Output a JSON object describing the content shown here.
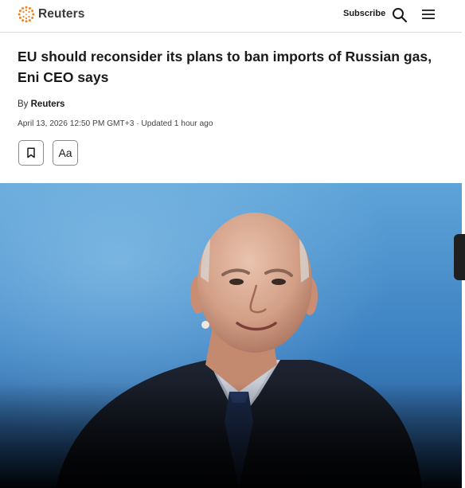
{
  "header": {
    "brand": "Reuters",
    "subscribe_label": "Subscribe",
    "search_icon": "search-icon",
    "menu_icon": "hamburger-menu-icon",
    "brand_color": "#f58220"
  },
  "article": {
    "headline": "EU should reconsider its plans to ban imports of Russian gas, Eni CEO says",
    "byline_prefix": "By",
    "author": "Reuters",
    "dateline": "April 13, 2026 12:50 PM GMT+3 · Updated 1 hour ago",
    "tools": {
      "bookmark_icon": "bookmark-icon",
      "font_size_label": "Aa"
    }
  },
  "hero_image": {
    "subject": "photo-of-speaker"
  }
}
